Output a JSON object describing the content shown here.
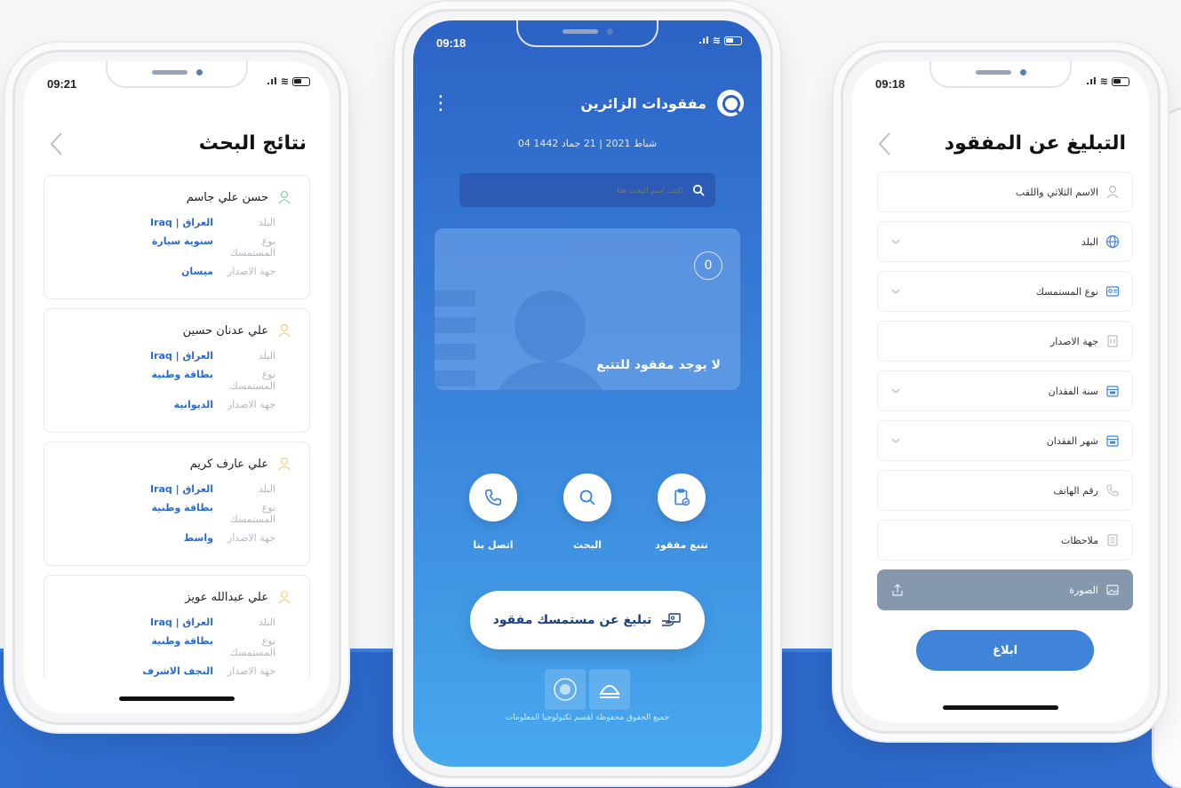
{
  "colors": {
    "primary": "#2c63c5",
    "accent": "#2a6ad1",
    "button": "#3f84d9",
    "photo_field": "#8598ad"
  },
  "left_phone": {
    "status_time": "09:21",
    "title": "نتائج البحث",
    "results": [
      {
        "name": "حسن علي جاسم",
        "country_key": "البلد",
        "country": "العراق | Iraq",
        "doc_key": "نوع المستمسك",
        "doc": "سنوية سيارة",
        "issuer_key": "جهة الاصدار",
        "issuer": "ميسان"
      },
      {
        "name": "علي عدنان حسين",
        "country_key": "البلد",
        "country": "العراق | Iraq",
        "doc_key": "نوع المستمسك",
        "doc": "بطاقة وطنية",
        "issuer_key": "جهة الاصدار",
        "issuer": "الديوانية"
      },
      {
        "name": "علي عارف كريم",
        "country_key": "البلد",
        "country": "العراق | Iraq",
        "doc_key": "نوع المستمسك",
        "doc": "بطاقة وطنية",
        "issuer_key": "جهة الاصدار",
        "issuer": "واسط"
      },
      {
        "name": "علي عبدالله عويز",
        "country_key": "البلد",
        "country": "العراق | Iraq",
        "doc_key": "نوع المستمسك",
        "doc": "بطاقة وطنية",
        "issuer_key": "جهة الاصدار",
        "issuer": "النجف الاشرف"
      }
    ]
  },
  "center_phone": {
    "status_time": "09:18",
    "app_title": "مفقودات الزائرين",
    "date": "04 شباط 2021 | 21 جماد 1442",
    "search_placeholder": "اكتب اسم البحث هنا",
    "tracked_count": "0",
    "empty_message": "لا يوجد مفقود للتتبع",
    "actions": [
      {
        "label": "اتصل بنا",
        "icon": "phone-icon"
      },
      {
        "label": "البحث",
        "icon": "search-icon"
      },
      {
        "label": "تتبع مفقود",
        "icon": "clipboard-check-icon"
      }
    ],
    "report_button": "تبليغ عن مستمسك مفقود",
    "footer": "جميع الحقوق محفوظة لقسم تكنولوجيا المعلومات"
  },
  "right_phone": {
    "status_time": "09:18",
    "title": "التبليغ عن المفقود",
    "fields": [
      {
        "label": "الاسم الثلاثي واللقب",
        "icon": "person-icon",
        "dropdown": false
      },
      {
        "label": "البلد",
        "icon": "globe-icon",
        "dropdown": true
      },
      {
        "label": "نوع المستمسك",
        "icon": "id-card-icon",
        "dropdown": true
      },
      {
        "label": "جهة الاصدار",
        "icon": "building-icon",
        "dropdown": false
      },
      {
        "label": "سنة الفقدان",
        "icon": "calendar-icon",
        "dropdown": true
      },
      {
        "label": "شهر الفقدان",
        "icon": "calendar-icon",
        "dropdown": true
      },
      {
        "label": "رقم الهاتف",
        "icon": "phone-icon",
        "dropdown": false
      },
      {
        "label": "ملاحظات",
        "icon": "notes-icon",
        "dropdown": false
      }
    ],
    "photo_label": "الصورة",
    "submit_label": "ابلاغ"
  }
}
